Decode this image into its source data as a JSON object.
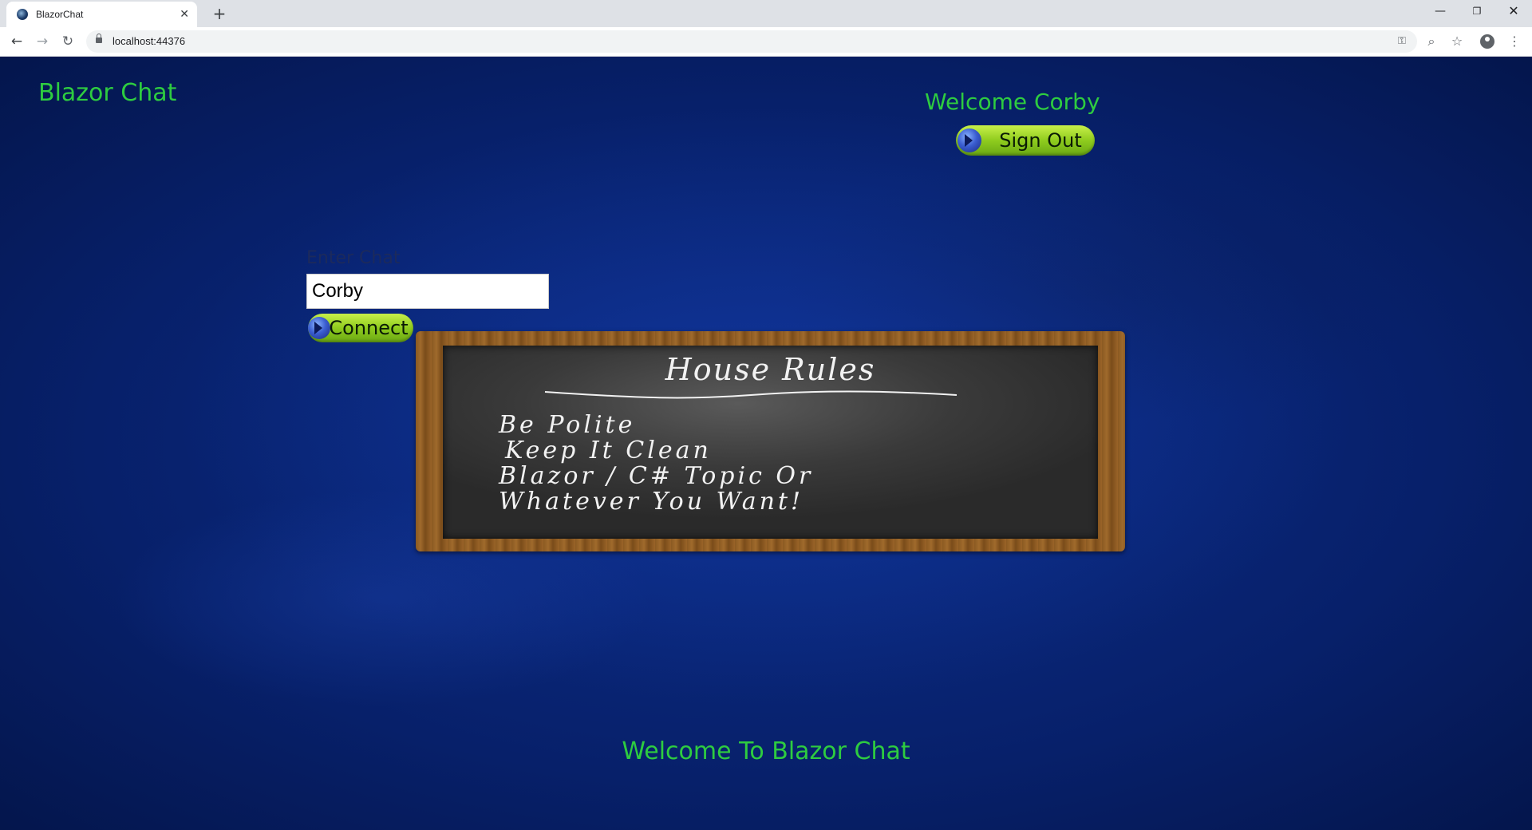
{
  "browser": {
    "tab_title": "BlazorChat",
    "tab_close_icon": "✕",
    "new_tab_icon": "+",
    "url": "localhost:44376",
    "window_controls": {
      "minimize": "—",
      "maximize": "❐",
      "close": "✕"
    },
    "nav": {
      "back": "←",
      "forward": "→",
      "reload": "↻"
    },
    "icons": {
      "key": "⚿",
      "zoom": "⌕",
      "star": "☆",
      "menu": "⋮"
    }
  },
  "header": {
    "brand": "Blazor Chat",
    "welcome": "Welcome Corby",
    "sign_out_label": "Sign Out"
  },
  "chat_form": {
    "label": "Enter Chat",
    "name_value": "Corby",
    "connect_label": "Connect"
  },
  "house_rules": {
    "title": "House Rules",
    "rules": [
      "Be Polite",
      "Keep It Clean",
      "Blazor / C# Topic Or",
      "Whatever You Want!"
    ]
  },
  "footer": {
    "welcome": "Welcome To Blazor Chat"
  },
  "colors": {
    "accent_green": "#2ecc40",
    "page_background": "#07206a",
    "button_green": "#8fcc1e"
  }
}
